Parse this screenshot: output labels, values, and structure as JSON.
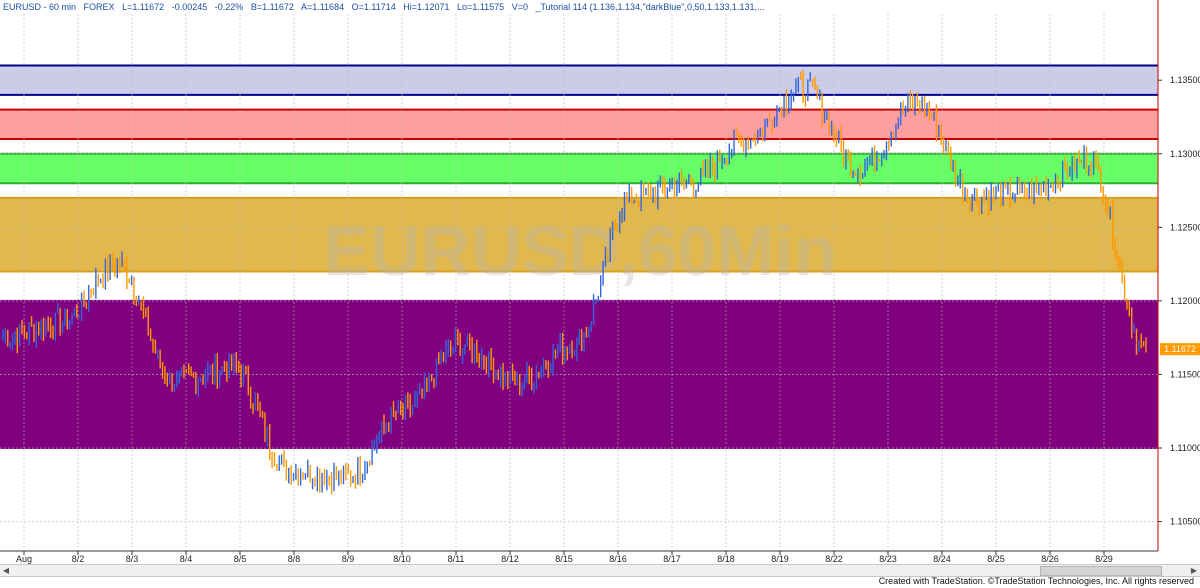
{
  "status": {
    "symbol": "EURUSD - 60 min",
    "market": "FOREX",
    "last": "L=1.11672",
    "change": "-0.00245",
    "change_pct": "-0.22%",
    "bid": "B=1.11672",
    "ask": "A=1.11684",
    "open": "O=1.11714",
    "high": "Hi=1.12071",
    "low": "Lo=1.11575",
    "volume": "V=0",
    "study": "_Tutorial 114 (1.136,1.134,\"darkBlue\",0,50,1.133,1.131,..."
  },
  "footer": {
    "credit": "Created with TradeStation. ©TradeStation Technologies, Inc. All rights reserved"
  },
  "chart_data": {
    "type": "candlestick",
    "watermark": "EURUSD,60Min",
    "ylim": [
      1.103,
      1.1395
    ],
    "y_ticks": [
      1.105,
      1.11,
      1.115,
      1.12,
      1.125,
      1.13,
      1.135
    ],
    "y_tick_labels": [
      "1.10500",
      "1.11000",
      "1.11500",
      "1.12000",
      "1.12500",
      "1.13000",
      "1.13500"
    ],
    "last_price": 1.11672,
    "last_price_label": "1.11672",
    "x_labels": [
      "Aug",
      "8/2",
      "8/3",
      "8/4",
      "8/5",
      "8/8",
      "8/9",
      "8/10",
      "8/11",
      "8/12",
      "8/15",
      "8/16",
      "8/17",
      "8/18",
      "8/19",
      "8/22",
      "8/23",
      "8/24",
      "8/25",
      "8/26",
      "8/29"
    ],
    "grid": true,
    "zones": [
      {
        "top": 1.136,
        "bottom": 1.134,
        "fill": "#cccce8",
        "border": "#00008b"
      },
      {
        "top": 1.133,
        "bottom": 1.131,
        "fill": "#ff9e9e",
        "border": "#c80000"
      },
      {
        "top": 1.13,
        "bottom": 1.128,
        "fill": "#66ff66",
        "border": "#33aa33"
      },
      {
        "top": 1.127,
        "bottom": 1.122,
        "fill": "#e0b84e",
        "border": "#d4a020"
      },
      {
        "top": 1.12,
        "bottom": 1.11,
        "fill": "#800080",
        "border": "#800080"
      }
    ],
    "series": [
      {
        "x": [
          "Aug",
          "8/2",
          "8/3",
          "8/4",
          "8/5",
          "8/8",
          "8/9",
          "8/10",
          "8/11",
          "8/12",
          "8/15",
          "8/16",
          "8/17",
          "8/18",
          "8/19",
          "8/22",
          "8/23",
          "8/24",
          "8/25",
          "8/26",
          "8/29"
        ],
        "close": [
          1.1175,
          1.1185,
          1.1225,
          1.1145,
          1.1155,
          1.1085,
          1.108,
          1.1125,
          1.117,
          1.1145,
          1.117,
          1.127,
          1.128,
          1.131,
          1.1345,
          1.129,
          1.1335,
          1.127,
          1.1275,
          1.1295,
          1.1167
        ]
      }
    ],
    "up_color": "#3366dd",
    "down_color": "#ff9900"
  }
}
